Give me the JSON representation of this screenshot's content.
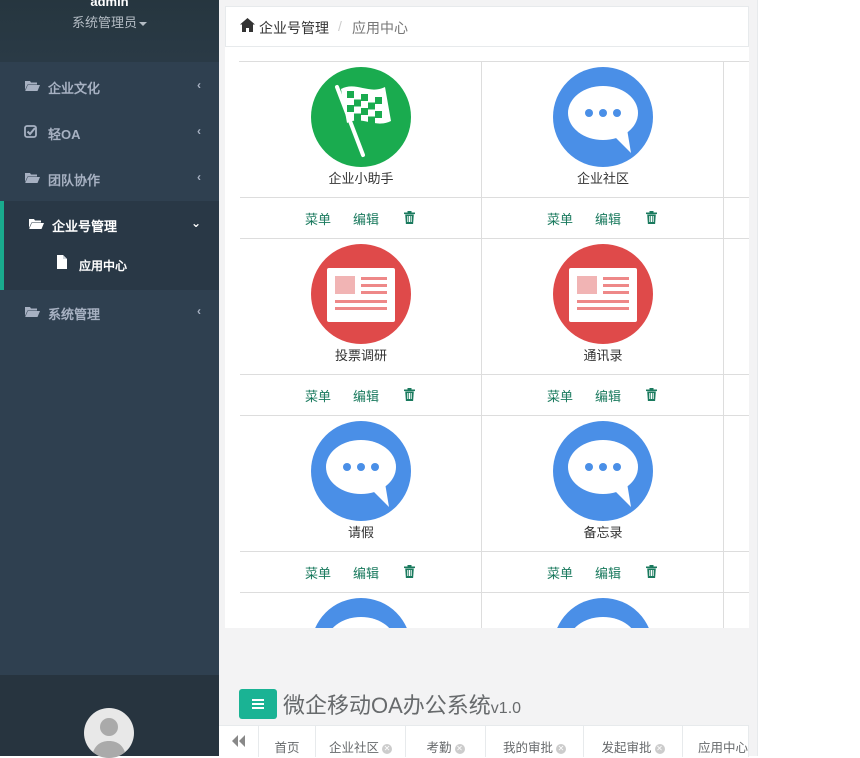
{
  "user": {
    "name": "admin",
    "role": "系统管理员"
  },
  "sidebar": {
    "items": [
      {
        "label": "企业文化",
        "icon": "folder-open-icon"
      },
      {
        "label": "轻OA",
        "icon": "check-square-icon"
      },
      {
        "label": "团队协作",
        "icon": "folder-open-icon"
      },
      {
        "label": "企业号管理",
        "icon": "folder-open-icon"
      },
      {
        "label": "系统管理",
        "icon": "folder-open-icon"
      }
    ],
    "sub_item": {
      "label": "应用中心",
      "icon": "file-icon"
    }
  },
  "breadcrumb": {
    "home": "企业号管理",
    "separator": "/",
    "current": "应用中心"
  },
  "apps": [
    {
      "label": "企业小助手",
      "icon": "checkered-flag-icon",
      "color": "#1aab4f"
    },
    {
      "label": "企业社区",
      "icon": "chat-bubble-icon",
      "color": "#4a8fe7"
    },
    {
      "label": "投票调研",
      "icon": "news-card-icon",
      "color": "#df4a4a"
    },
    {
      "label": "通讯录",
      "icon": "news-card-icon",
      "color": "#df4a4a"
    },
    {
      "label": "请假",
      "icon": "chat-bubble-icon",
      "color": "#4a8fe7"
    },
    {
      "label": "备忘录",
      "icon": "chat-bubble-icon",
      "color": "#4a8fe7"
    },
    {
      "label": "",
      "icon": "chat-bubble-icon",
      "color": "#4a8fe7"
    },
    {
      "label": "",
      "icon": "chat-bubble-icon",
      "color": "#4a8fe7"
    }
  ],
  "actions": {
    "menu": "菜单",
    "edit": "编辑",
    "delete_icon": "trash-icon"
  },
  "brand": {
    "title": "微企移动OA办公系统",
    "version": "v1.0"
  },
  "tabs": [
    {
      "label": "首页",
      "closable": false
    },
    {
      "label": "企业社区",
      "closable": true
    },
    {
      "label": "考勤",
      "closable": true
    },
    {
      "label": "我的审批",
      "closable": true
    },
    {
      "label": "发起审批",
      "closable": true
    },
    {
      "label": "应用中心",
      "closable": false
    }
  ],
  "colors": {
    "sidebar": "#2f4050",
    "accent": "#1ab394",
    "action": "#1a7a5e"
  }
}
